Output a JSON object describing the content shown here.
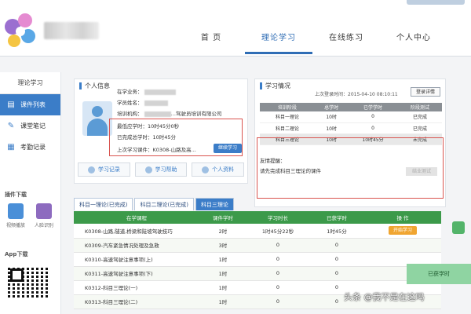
{
  "header": {
    "nav": [
      {
        "label": "首 页",
        "active": false
      },
      {
        "label": "理论学习",
        "active": true
      },
      {
        "label": "在线练习",
        "active": false
      },
      {
        "label": "个人中心",
        "active": false
      }
    ]
  },
  "sidebar": {
    "title": "理论学习",
    "items": [
      {
        "label": "课件列表",
        "icon": "courseware-icon",
        "active": true
      },
      {
        "label": "课堂笔记",
        "icon": "notes-icon",
        "active": false
      },
      {
        "label": "考勤记录",
        "icon": "attendance-icon",
        "active": false
      }
    ],
    "plugins_title": "插件下载",
    "plugins": [
      {
        "label": "视频播放",
        "color": "#4a8fd8"
      },
      {
        "label": "人脸识别",
        "color": "#8d6bbf"
      }
    ],
    "app_title": "App下载"
  },
  "personal": {
    "title": "个人信息",
    "lines": [
      {
        "key": "在学业务："
      },
      {
        "key": "学员姓名："
      },
      {
        "key": "培训机构：",
        "value": "…驾驶员培训有限公司"
      },
      {
        "key": "最低应学时：",
        "value": "10时45分0秒"
      },
      {
        "key": "已完成总学时：",
        "value": "10时45分"
      },
      {
        "key": "上次学习课件：",
        "value": "K0308-山路及高..."
      }
    ],
    "continue_button": "继续学习",
    "quick": [
      "学习记录",
      "学习帮助",
      "个人资料"
    ]
  },
  "study": {
    "title": "学习情况",
    "last_login": "上次登录时间：2015-04-10 08:10:11",
    "login_button": "登录详情",
    "headers": [
      "培训阶段",
      "总学时",
      "已学学时",
      "阶段测试"
    ],
    "rows": [
      [
        "科目一理论",
        "10时",
        "0",
        "已完成"
      ],
      [
        "科目二理论",
        "10时",
        "0",
        "已完成"
      ],
      [
        "科目三理论",
        "10时",
        "10时45分",
        "未完成"
      ]
    ],
    "reminder_title": "友情提醒：",
    "reminder_text": "请先完成科目三理论的课件",
    "final_button": "结业测试"
  },
  "course": {
    "tabs": [
      {
        "label": "科目一理论(已完成)",
        "active": false
      },
      {
        "label": "科目二理论(已完成)",
        "active": false
      },
      {
        "label": "科目三理论",
        "active": true
      }
    ],
    "headers": [
      "在学课程",
      "课件学时",
      "学习时长",
      "已获学时",
      "操 作"
    ],
    "rows": [
      [
        "K0308-山路,隧道,桥梁和陡坡驾驶技巧",
        "2时",
        "1时45分22秒",
        "1时45分",
        "开始学习"
      ],
      [
        "K0309-汽车紧急情况处理及急救",
        "3时",
        "0",
        "0",
        ""
      ],
      [
        "K0310-高速驾驶注意事项(上)",
        "1时",
        "0",
        "0",
        ""
      ],
      [
        "K0311-高速驾驶注意事项(下)",
        "1时",
        "0",
        "0",
        ""
      ],
      [
        "K0312-科目三理论(一)",
        "1时",
        "0",
        "0",
        ""
      ],
      [
        "K0313-科目三理论(二)",
        "1时",
        "0",
        "0",
        ""
      ]
    ]
  },
  "floating": {
    "hours_label": "已获学时"
  },
  "watermark": "头条 @我不是在这吗"
}
